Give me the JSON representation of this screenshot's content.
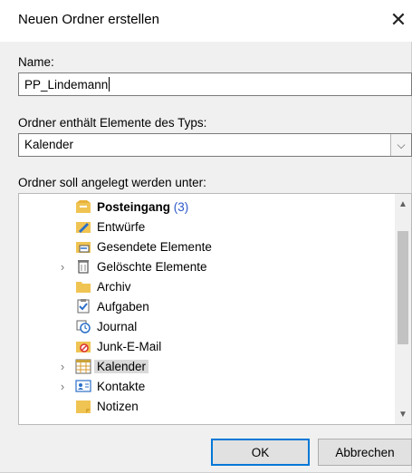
{
  "dialog": {
    "title": "Neuen Ordner erstellen",
    "close_glyph": "✕"
  },
  "name_field": {
    "label": "Name:",
    "value": "PP_Lindemann"
  },
  "type_field": {
    "label": "Ordner enthält Elemente des Typs:",
    "value": "Kalender",
    "dropdown_glyph": "⌵"
  },
  "tree": {
    "label": "Ordner soll angelegt werden unter:",
    "items": [
      {
        "label": "Posteingang",
        "count": "(3)",
        "icon": "inbox-icon",
        "expander": "",
        "bold": true
      },
      {
        "label": "Entwürfe",
        "icon": "drafts-icon",
        "expander": ""
      },
      {
        "label": "Gesendete Elemente",
        "icon": "sent-items-icon",
        "expander": ""
      },
      {
        "label": "Gelöschte Elemente",
        "icon": "trash-icon",
        "expander": "›"
      },
      {
        "label": "Archiv",
        "icon": "folder-icon",
        "expander": ""
      },
      {
        "label": "Aufgaben",
        "icon": "tasks-icon",
        "expander": ""
      },
      {
        "label": "Journal",
        "icon": "journal-icon",
        "expander": ""
      },
      {
        "label": "Junk-E-Mail",
        "icon": "junk-mail-icon",
        "expander": ""
      },
      {
        "label": "Kalender",
        "icon": "calendar-icon",
        "expander": "›",
        "selected": true
      },
      {
        "label": "Kontakte",
        "icon": "contacts-icon",
        "expander": "›"
      },
      {
        "label": "Notizen",
        "icon": "notes-icon",
        "expander": ""
      }
    ],
    "scroll_up_glyph": "▲",
    "scroll_down_glyph": "▼"
  },
  "buttons": {
    "ok": "OK",
    "cancel": "Abbrechen"
  },
  "colors": {
    "accent": "#0078d7",
    "folder": "#f0c453",
    "selection": "#d9d9d9",
    "count": "#2b57c9"
  }
}
